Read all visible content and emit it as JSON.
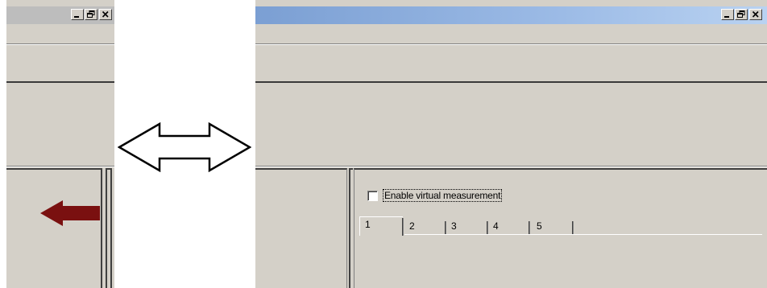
{
  "colors": {
    "window_face": "#d4d0c8",
    "title_gradient_start": "#7b9fd3",
    "title_gradient_end": "#b9d2f1",
    "red_arrow": "#7a1010"
  },
  "icons": {
    "minimize": "minimize-icon",
    "restore": "restore-icon",
    "close": "close-icon",
    "double_arrow": "double-arrow-icon",
    "red_arrow": "left-arrow-icon"
  },
  "content": {
    "checkbox_label": "Enable virtual measurement",
    "checkbox_checked": false,
    "tabs": [
      "1",
      "2",
      "3",
      "4",
      "5"
    ],
    "selected_tab": "1"
  }
}
